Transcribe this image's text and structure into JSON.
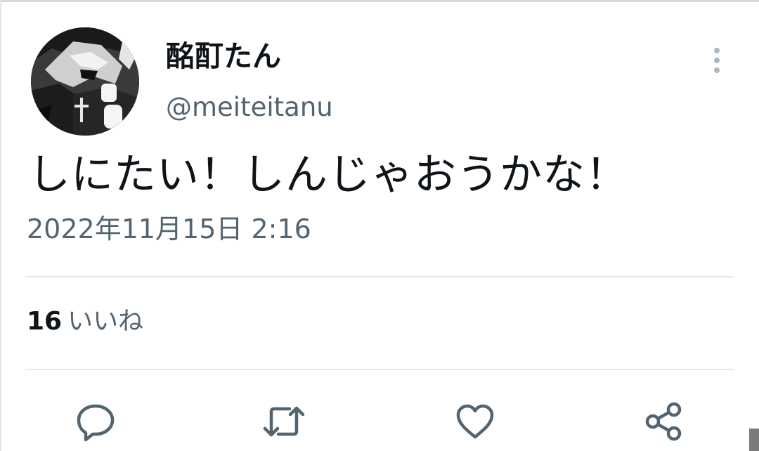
{
  "tweet": {
    "display_name": "酩酊たん",
    "handle": "@meiteitanu",
    "text": "しにたい！しんじゃおうかな！",
    "timestamp": "2022年11月15日 2:16",
    "likes_count": "16",
    "likes_label": "いいね"
  },
  "icons": {
    "more": "more-vertical-icon",
    "reply": "reply-icon",
    "retweet": "retweet-icon",
    "like": "heart-icon",
    "share": "share-icon"
  },
  "colors": {
    "text_primary": "#0f1419",
    "text_secondary": "#536471",
    "icon": "#536471",
    "divider": "#e6e9eb"
  }
}
